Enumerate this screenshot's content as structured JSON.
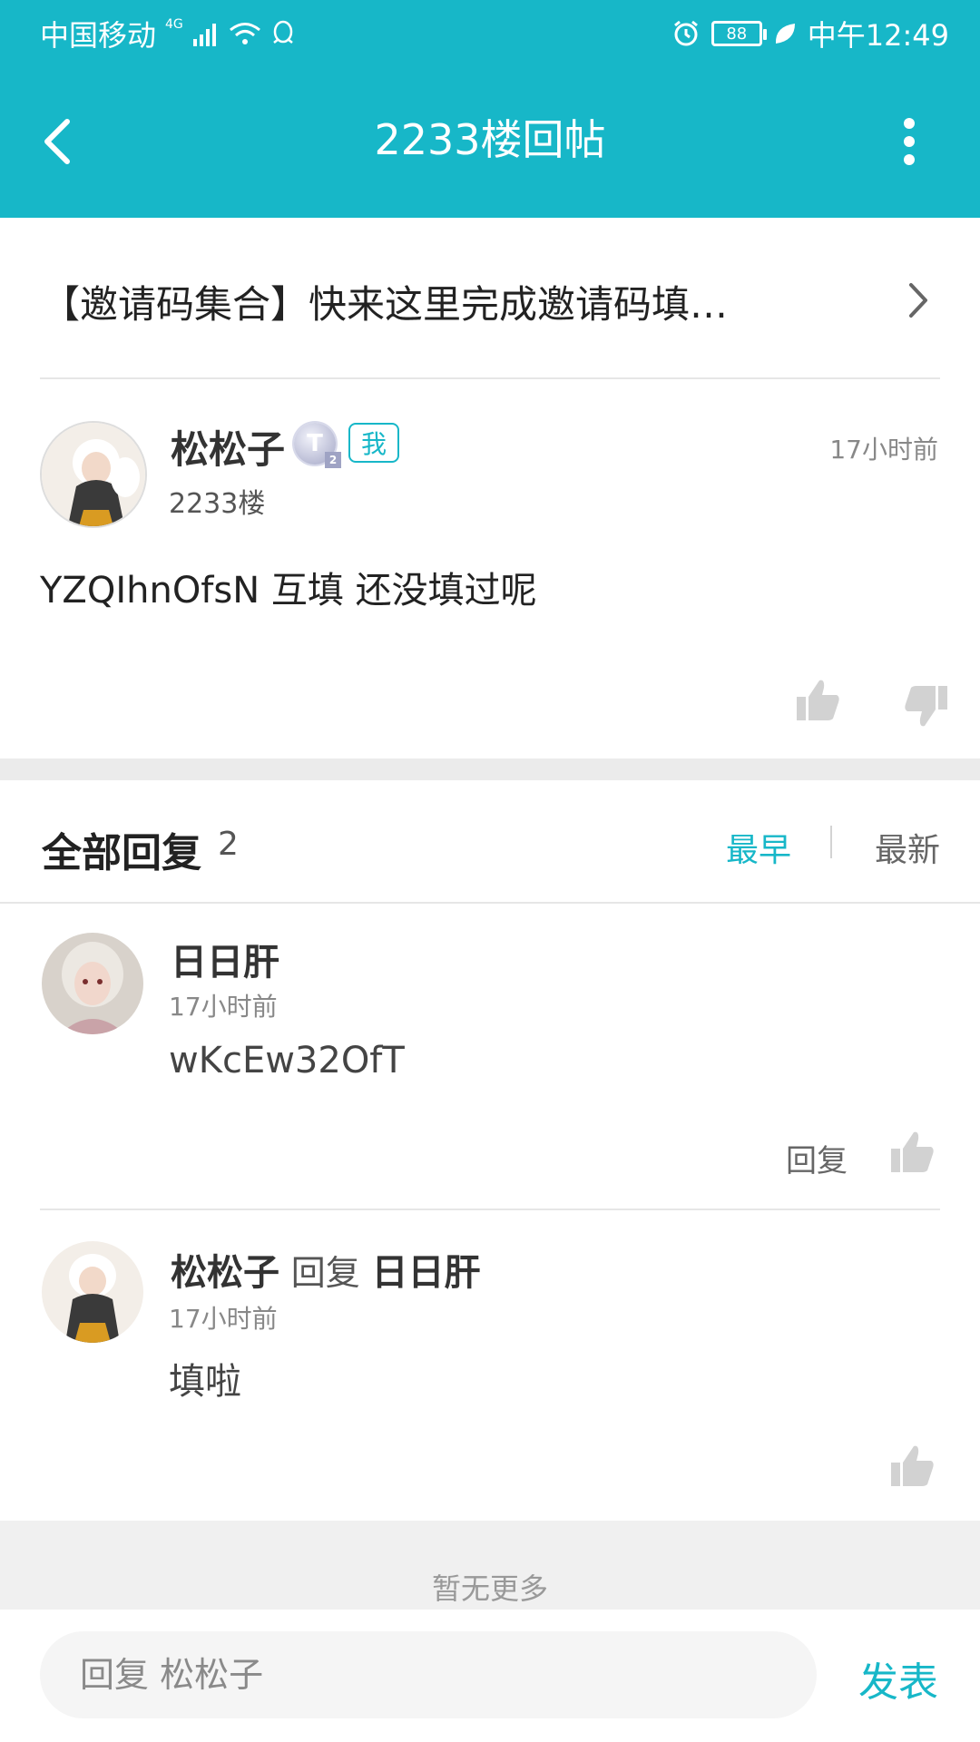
{
  "status_bar": {
    "carrier": "中国移动",
    "network": "4G",
    "battery": "88",
    "time": "中午12:49"
  },
  "app_bar": {
    "title": "2233楼回帖"
  },
  "thread": {
    "title": "【邀请码集合】快来这里完成邀请码填…"
  },
  "post": {
    "author": "松松子",
    "level_badge": "T",
    "level_sub": "2",
    "me_tag": "我",
    "floor": "2233楼",
    "time": "17小时前",
    "content": "YZQIhnOfsN 互填 还没填过呢"
  },
  "replies_header": {
    "title": "全部回复",
    "count": "2",
    "sort_early": "最早",
    "sort_new": "最新"
  },
  "replies": [
    {
      "author": "日日肝",
      "time": "17小时前",
      "content": "wKcEw32OfT",
      "reply_label": "回复"
    },
    {
      "author": "松松子",
      "reply_verb": "回复",
      "reply_to": "日日肝",
      "time": "17小时前",
      "content": "填啦"
    }
  ],
  "footer": {
    "no_more": "暂无更多",
    "input_placeholder": "回复 松松子",
    "send": "发表"
  },
  "colors": {
    "accent": "#17b7c8"
  }
}
